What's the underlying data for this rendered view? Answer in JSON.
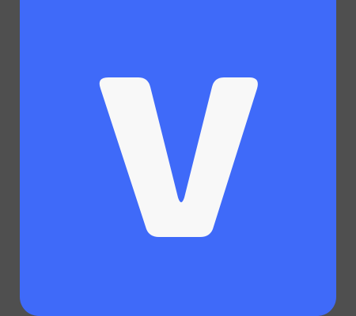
{
  "app_icon": {
    "name": "V logo",
    "icon": "v-letter-logo-icon",
    "colors": {
      "page_background": "#4f4f4f",
      "tile": "#3f6af9",
      "glyph": "#f8f8f8"
    }
  }
}
